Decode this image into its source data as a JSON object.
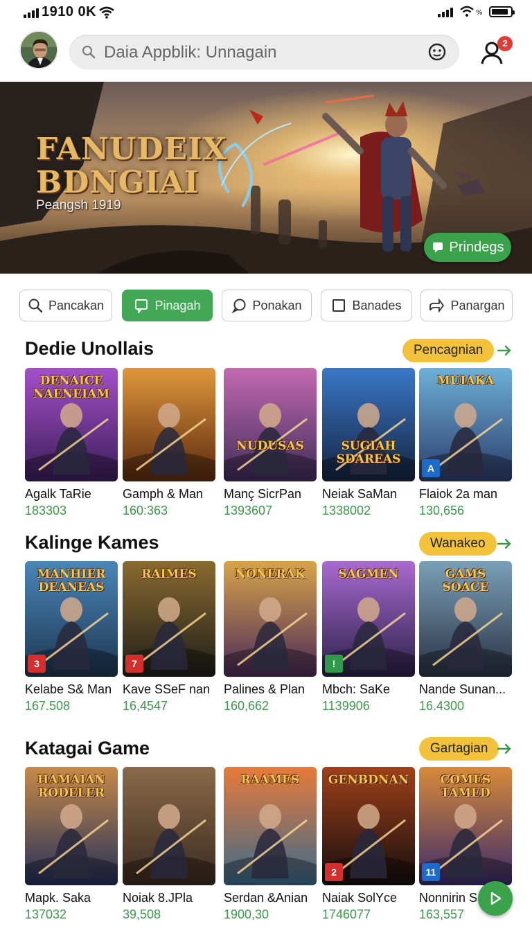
{
  "status_bar": {
    "time": "1910 0K",
    "battery_level": 0.9
  },
  "header": {
    "search_placeholder": "Daia Appblik: Unnagain",
    "notification_count": "2"
  },
  "hero": {
    "title_line1": "FANUDEIX",
    "title_line2": "BDNGIAI",
    "subtitle": "Peangsh 1919",
    "button_label": "Prindegs"
  },
  "filters": [
    {
      "label": "Pancakan",
      "icon": "search-icon",
      "active": false
    },
    {
      "label": "Pinagah",
      "icon": "chat-icon",
      "active": true
    },
    {
      "label": "Ponakan",
      "icon": "bubble-icon",
      "active": false
    },
    {
      "label": "Banades",
      "icon": "square-icon",
      "active": false
    },
    {
      "label": "Panargan",
      "icon": "share-icon",
      "active": false
    }
  ],
  "sections": [
    {
      "title": "Dedie Unollais",
      "pill": "Pencagnian",
      "cards": [
        {
          "art": "DENAICE NAENEIAM",
          "name": "Agalk TaRie",
          "count": "183303"
        },
        {
          "art": "",
          "name": "Gamph & Man",
          "count": "160:363"
        },
        {
          "art": "NUDUSAS",
          "name": "Manç SicrPan",
          "count": "1393607"
        },
        {
          "art": "SUGIAH SDAREAS",
          "name": "Neiak SaMan",
          "count": "1338002"
        },
        {
          "art": "MUIAKA",
          "name": "Flaiok 2a man",
          "count": "130,656"
        }
      ]
    },
    {
      "title": "Kalinge Kames",
      "pill": "Wanakeo",
      "cards": [
        {
          "art": "MANHIER DEANEAS",
          "name": "Kelabe S& Man",
          "count": "167.508"
        },
        {
          "art": "RAIMES",
          "name": "Kave SSeF nan",
          "count": "16,4547"
        },
        {
          "art": "NONERAK",
          "name": "Palines & Plan",
          "count": "160,662"
        },
        {
          "art": "SAGMEN",
          "name": "Mbch: SaKe",
          "count": "1139906"
        },
        {
          "art": "GAMS SOACE",
          "name": "Nande Sunan...",
          "count": "16.4300"
        }
      ]
    },
    {
      "title": "Katagai Game",
      "pill": "Gartagian",
      "cards": [
        {
          "art": "HAMAIAN RODELER",
          "name": "Mapk. Saka",
          "count": "137032"
        },
        {
          "art": "",
          "name": "Noiak 8.JPla",
          "count": "39,508"
        },
        {
          "art": "RAAMES",
          "name": "Serdan &Anian",
          "count": "1900,30"
        },
        {
          "art": "GENBDNAN",
          "name": "Naiak SolYce",
          "count": "1746077"
        },
        {
          "art": "COMES TAMED",
          "name": "Nonnirin S",
          "count": "163,557"
        }
      ]
    }
  ],
  "colors": {
    "accent": "#42a856",
    "pill": "#f2c23a",
    "count": "#3a9a4a",
    "badge": "#e53935"
  }
}
